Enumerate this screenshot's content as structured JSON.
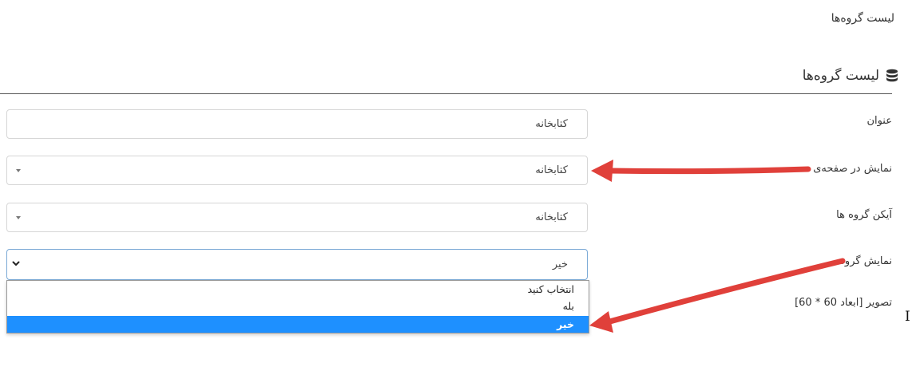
{
  "page": {
    "title": "لیست گروه‌ها"
  },
  "section": {
    "title": "لیست گروه‌ها",
    "icon": "database-icon"
  },
  "form": {
    "title_field": {
      "label": "عنوان",
      "value": "کتابخانه"
    },
    "display_page_field": {
      "label": "نمایش در صفحه‌ی",
      "value": "کتابخانه"
    },
    "group_icon_field": {
      "label": "آیکن گروه ها",
      "value": "کتابخانه"
    },
    "show_group_field": {
      "label": "نمایش گروه",
      "value": "خیر",
      "options": [
        "انتخاب کنید",
        "بله",
        "خیر"
      ],
      "selected_index": 2
    },
    "image_field": {
      "label": "تصویر [ابعاد 60 * 60]"
    }
  },
  "colors": {
    "annotation_arrow": "#e0403a",
    "highlight": "#1e90ff",
    "focus_border": "#7aa9d6"
  }
}
